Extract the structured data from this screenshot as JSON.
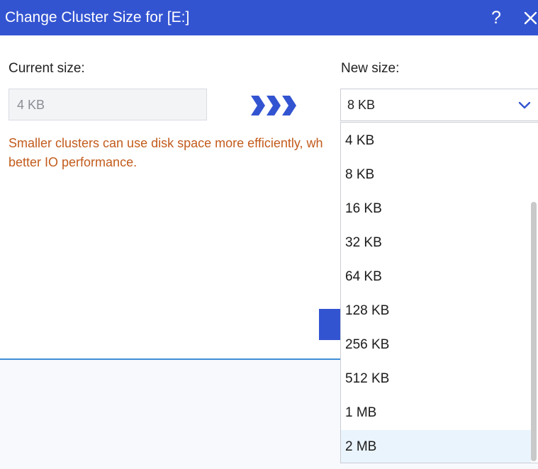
{
  "window": {
    "title": "Change Cluster Size for [E:]",
    "help_label": "?",
    "close_icon": "close-icon"
  },
  "current": {
    "label": "Current size:",
    "value": "4 KB"
  },
  "new_size": {
    "label": "New size:",
    "selected": "8 KB",
    "options": [
      "4 KB",
      "8 KB",
      "16 KB",
      "32 KB",
      "64 KB",
      "128 KB",
      "256 KB",
      "512 KB",
      "1 MB",
      "2 MB"
    ],
    "hovered": "2 MB"
  },
  "note": {
    "line1": "Smaller clusters can use disk space more efficiently, wh",
    "line2": "better IO performance."
  },
  "colors": {
    "titlebar": "#3354d1",
    "accent": "#3354d1",
    "note_text": "#c35b1c",
    "hover_row": "#eaf4fd"
  }
}
